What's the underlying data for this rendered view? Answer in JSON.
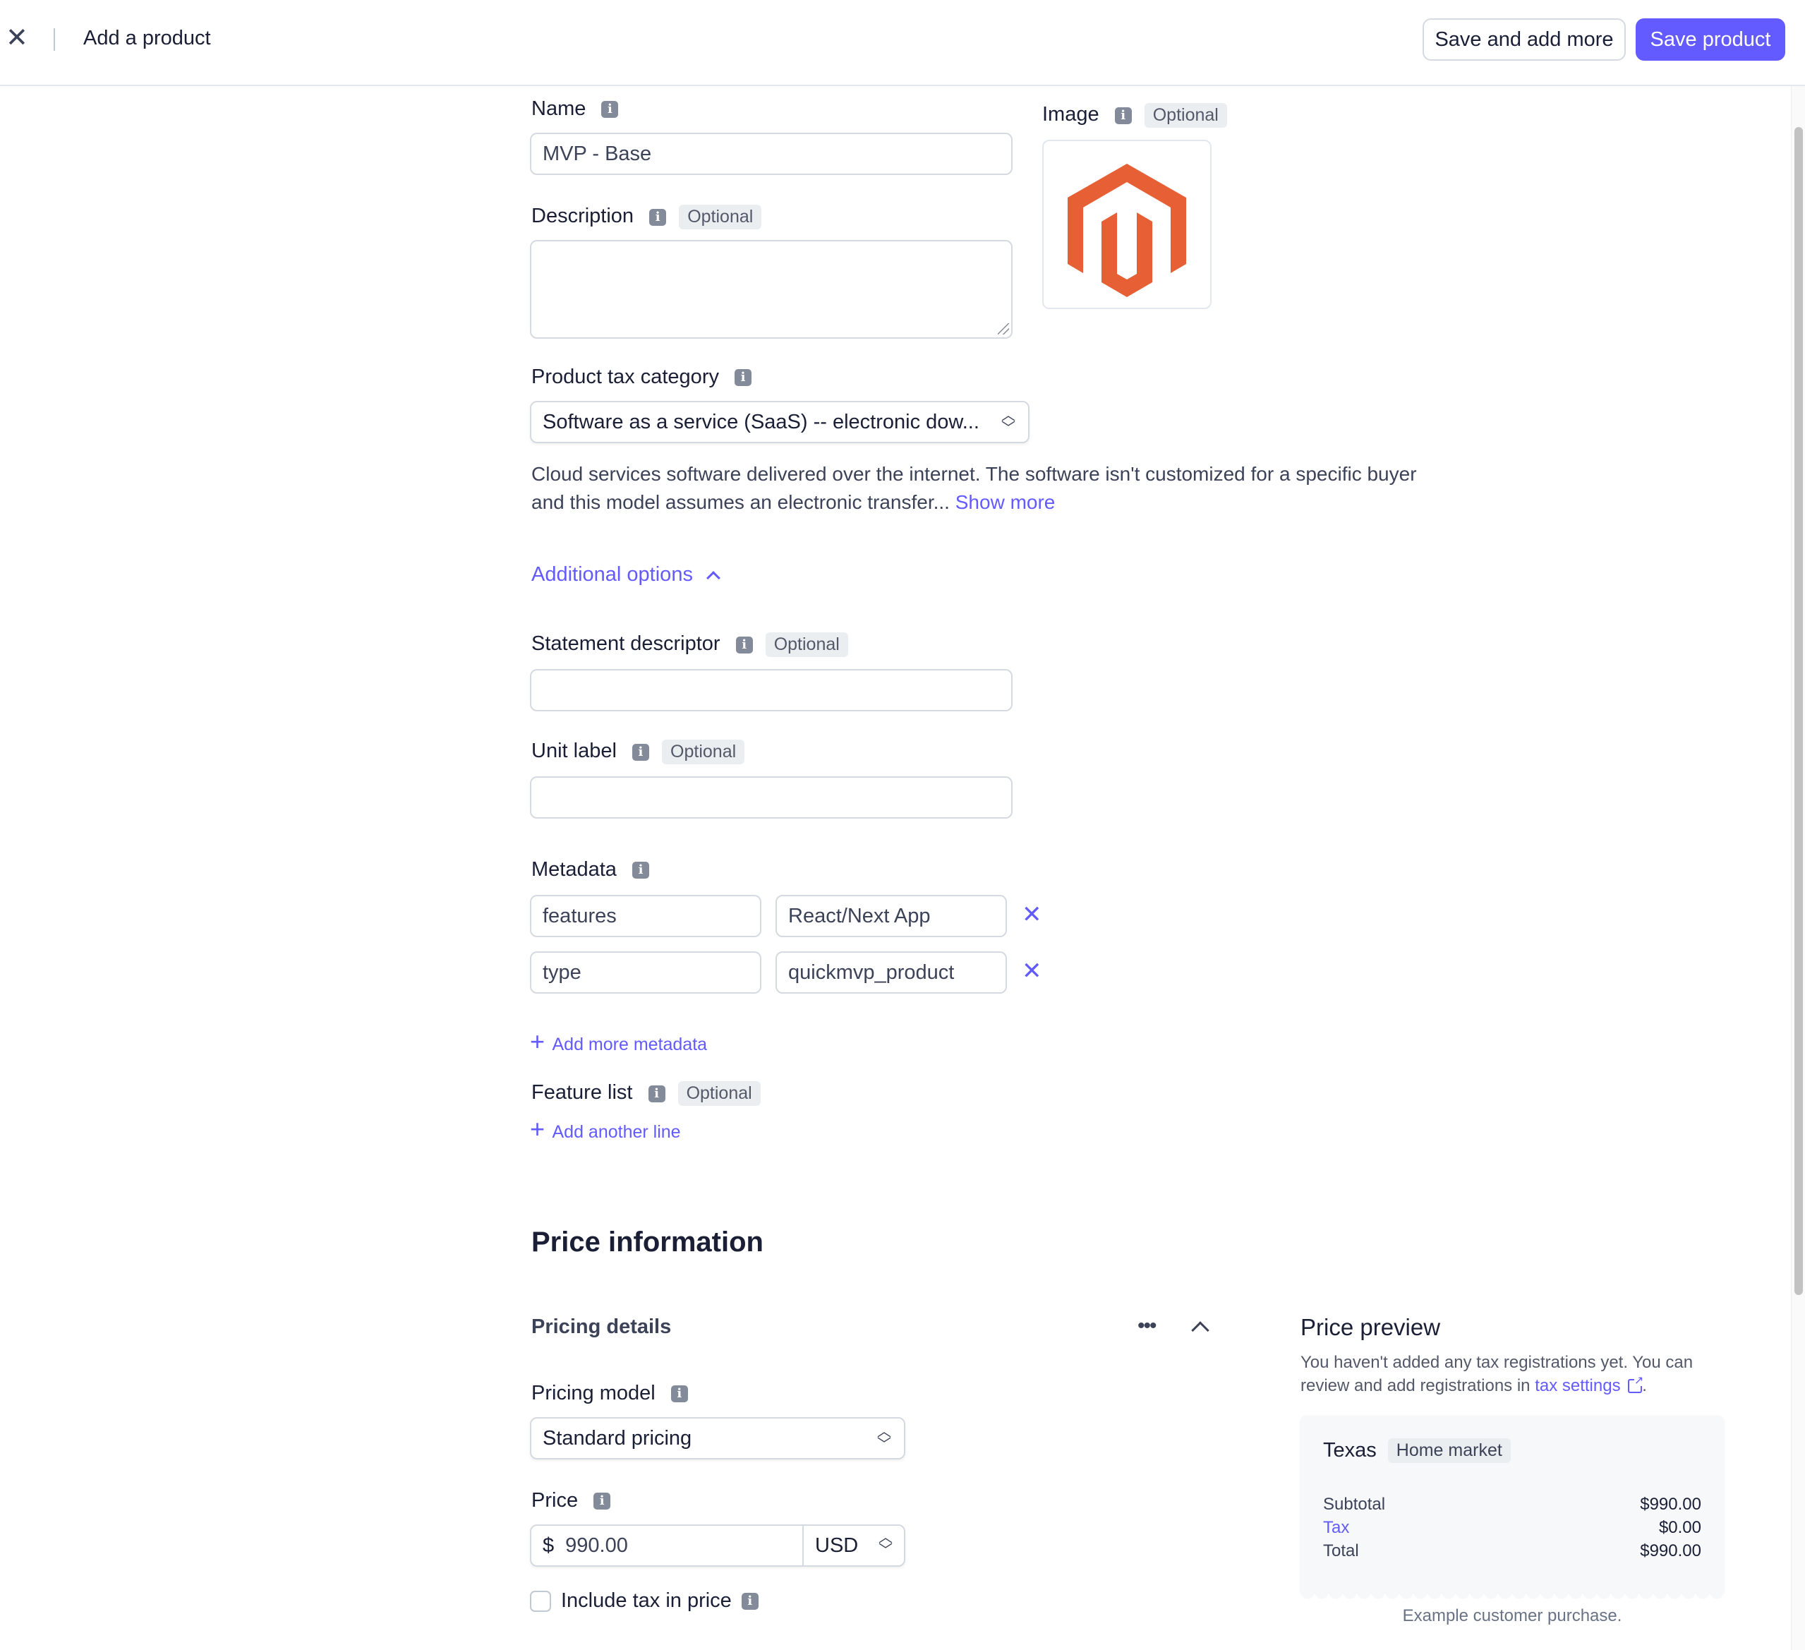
{
  "header": {
    "title": "Add a product",
    "save_more_label": "Save and add more",
    "save_label": "Save product"
  },
  "name": {
    "label": "Name",
    "value": "MVP - Base"
  },
  "description": {
    "label": "Description",
    "optional": "Optional",
    "value": ""
  },
  "image": {
    "label": "Image",
    "optional": "Optional"
  },
  "tax_category": {
    "label": "Product tax category",
    "value": "Software as a service (SaaS) -- electronic dow...",
    "help_line1": "Cloud services software delivered over the internet. The software isn't customized for a specific buyer",
    "help_line2": "and this model assumes an electronic transfer...",
    "show_more": "Show more"
  },
  "additional_options": "Additional options",
  "statement_descriptor": {
    "label": "Statement descriptor",
    "optional": "Optional",
    "value": ""
  },
  "unit_label": {
    "label": "Unit label",
    "optional": "Optional",
    "value": ""
  },
  "metadata": {
    "label": "Metadata",
    "rows": [
      {
        "key": "features",
        "value": "React/Next App"
      },
      {
        "key": "type",
        "value": "quickmvp_product"
      }
    ],
    "add_more": "Add more metadata"
  },
  "feature_list": {
    "label": "Feature list",
    "optional": "Optional",
    "add_line": "Add another line"
  },
  "price_information": {
    "heading": "Price information",
    "pricing_details": "Pricing details",
    "pricing_model": {
      "label": "Pricing model",
      "value": "Standard pricing"
    },
    "price": {
      "label": "Price",
      "symbol": "$",
      "value": "990.00",
      "currency": "USD"
    },
    "include_tax": {
      "label": "Include tax in price",
      "checked": false
    }
  },
  "price_preview": {
    "title": "Price preview",
    "note_line1": "You haven't added any tax registrations yet. You can",
    "note_line2": "review and add registrations in",
    "tax_settings_link": "tax settings",
    "note_end": ".",
    "region": "Texas",
    "region_badge": "Home market",
    "rows": [
      {
        "label": "Subtotal",
        "value": "$990.00"
      },
      {
        "label": "Tax",
        "value": "$0.00"
      },
      {
        "label": "Total",
        "value": "$990.00"
      }
    ],
    "caption": "Example customer purchase."
  },
  "colors": {
    "accent": "#635bff",
    "logo": "#e65f35",
    "text": "#1a1f36"
  }
}
